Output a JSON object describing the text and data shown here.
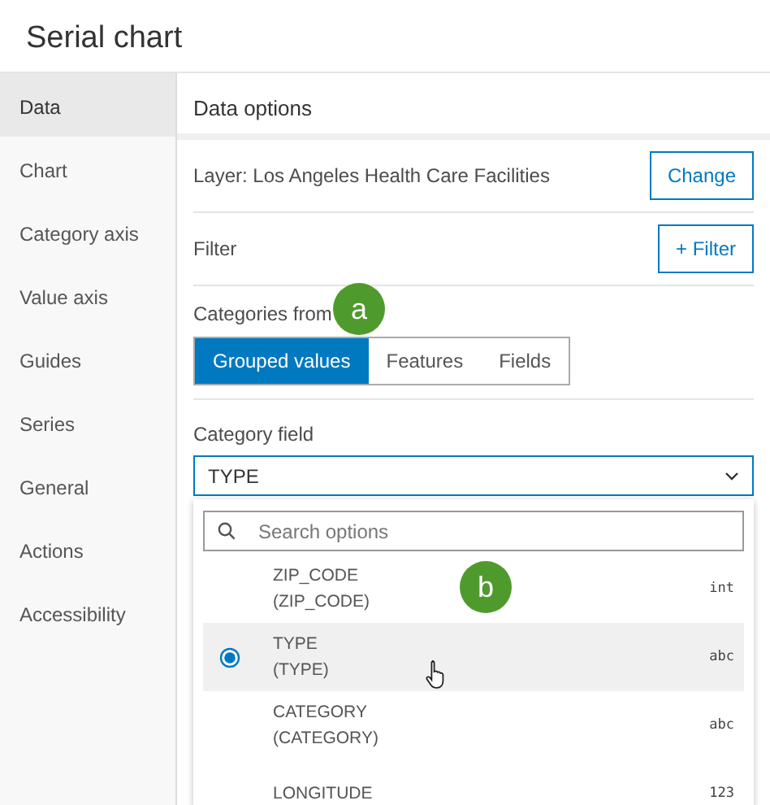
{
  "window": {
    "title": "Serial chart"
  },
  "sidebar": {
    "items": [
      {
        "label": "Data",
        "selected": true
      },
      {
        "label": "Chart",
        "selected": false
      },
      {
        "label": "Category axis",
        "selected": false
      },
      {
        "label": "Value axis",
        "selected": false
      },
      {
        "label": "Guides",
        "selected": false
      },
      {
        "label": "Series",
        "selected": false
      },
      {
        "label": "General",
        "selected": false
      },
      {
        "label": "Actions",
        "selected": false
      },
      {
        "label": "Accessibility",
        "selected": false
      }
    ]
  },
  "panel": {
    "title": "Data options",
    "layer": {
      "label": "Layer: Los Angeles Health Care Facilities",
      "button": "Change"
    },
    "filter": {
      "label": "Filter",
      "button": "+ Filter"
    },
    "categories_from": {
      "label": "Categories from",
      "options": [
        {
          "label": "Grouped values",
          "selected": true
        },
        {
          "label": "Features",
          "selected": false
        },
        {
          "label": "Fields",
          "selected": false
        }
      ]
    },
    "category_field": {
      "label": "Category field",
      "value": "TYPE",
      "dropdown": {
        "placeholder": "Search options",
        "options": [
          {
            "name": "ZIP_CODE",
            "alias": "(ZIP_CODE)",
            "type": "int",
            "selected": false,
            "hovered": false
          },
          {
            "name": "TYPE",
            "alias": "(TYPE)",
            "type": "abc",
            "selected": true,
            "hovered": true
          },
          {
            "name": "CATEGORY",
            "alias": "(CATEGORY)",
            "type": "abc",
            "selected": false,
            "hovered": false
          },
          {
            "name": "LONGITUDE",
            "type": "123",
            "selected": false,
            "hovered": false
          }
        ]
      }
    }
  },
  "callouts": [
    {
      "label": "a"
    },
    {
      "label": "b"
    }
  ]
}
